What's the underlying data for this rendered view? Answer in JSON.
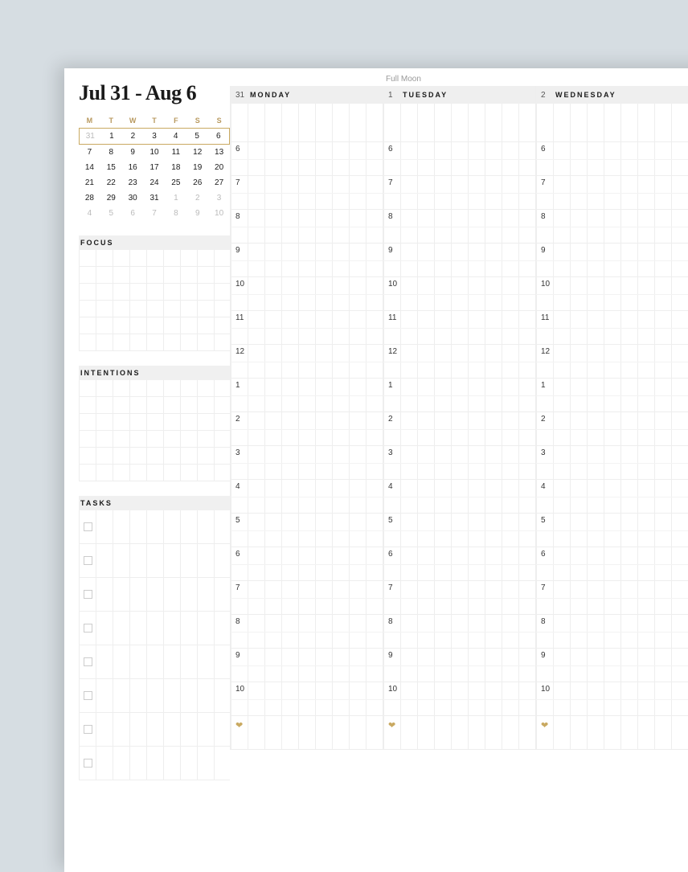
{
  "title": "Jul 31 - Aug 6",
  "moon": "Full Moon",
  "miniCal": {
    "headers": [
      "M",
      "T",
      "W",
      "T",
      "F",
      "S",
      "S"
    ],
    "rows": [
      {
        "highlight": true,
        "cells": [
          {
            "v": "31",
            "dim": true
          },
          {
            "v": "1"
          },
          {
            "v": "2"
          },
          {
            "v": "3"
          },
          {
            "v": "4"
          },
          {
            "v": "5"
          },
          {
            "v": "6"
          }
        ]
      },
      {
        "cells": [
          {
            "v": "7"
          },
          {
            "v": "8"
          },
          {
            "v": "9"
          },
          {
            "v": "10"
          },
          {
            "v": "11"
          },
          {
            "v": "12"
          },
          {
            "v": "13"
          }
        ]
      },
      {
        "cells": [
          {
            "v": "14"
          },
          {
            "v": "15"
          },
          {
            "v": "16"
          },
          {
            "v": "17"
          },
          {
            "v": "18"
          },
          {
            "v": "19"
          },
          {
            "v": "20"
          }
        ]
      },
      {
        "cells": [
          {
            "v": "21"
          },
          {
            "v": "22"
          },
          {
            "v": "23"
          },
          {
            "v": "24"
          },
          {
            "v": "25"
          },
          {
            "v": "26"
          },
          {
            "v": "27"
          }
        ]
      },
      {
        "cells": [
          {
            "v": "28"
          },
          {
            "v": "29"
          },
          {
            "v": "30"
          },
          {
            "v": "31"
          },
          {
            "v": "1",
            "dim": true
          },
          {
            "v": "2",
            "dim": true
          },
          {
            "v": "3",
            "dim": true
          }
        ]
      },
      {
        "cells": [
          {
            "v": "4",
            "dim": true
          },
          {
            "v": "5",
            "dim": true
          },
          {
            "v": "6",
            "dim": true
          },
          {
            "v": "7",
            "dim": true
          },
          {
            "v": "8",
            "dim": true
          },
          {
            "v": "9",
            "dim": true
          },
          {
            "v": "10",
            "dim": true
          }
        ]
      }
    ]
  },
  "sections": {
    "focus": "FOCUS",
    "intentions": "INTENTIONS",
    "tasks": "TASKS"
  },
  "days": [
    {
      "num": "31",
      "name": "MONDAY"
    },
    {
      "num": "1",
      "name": "TUESDAY"
    },
    {
      "num": "2",
      "name": "WEDNESDAY"
    }
  ],
  "hours": [
    "6",
    "7",
    "8",
    "9",
    "10",
    "11",
    "12",
    "1",
    "2",
    "3",
    "4",
    "5",
    "6",
    "7",
    "8",
    "9",
    "10"
  ]
}
